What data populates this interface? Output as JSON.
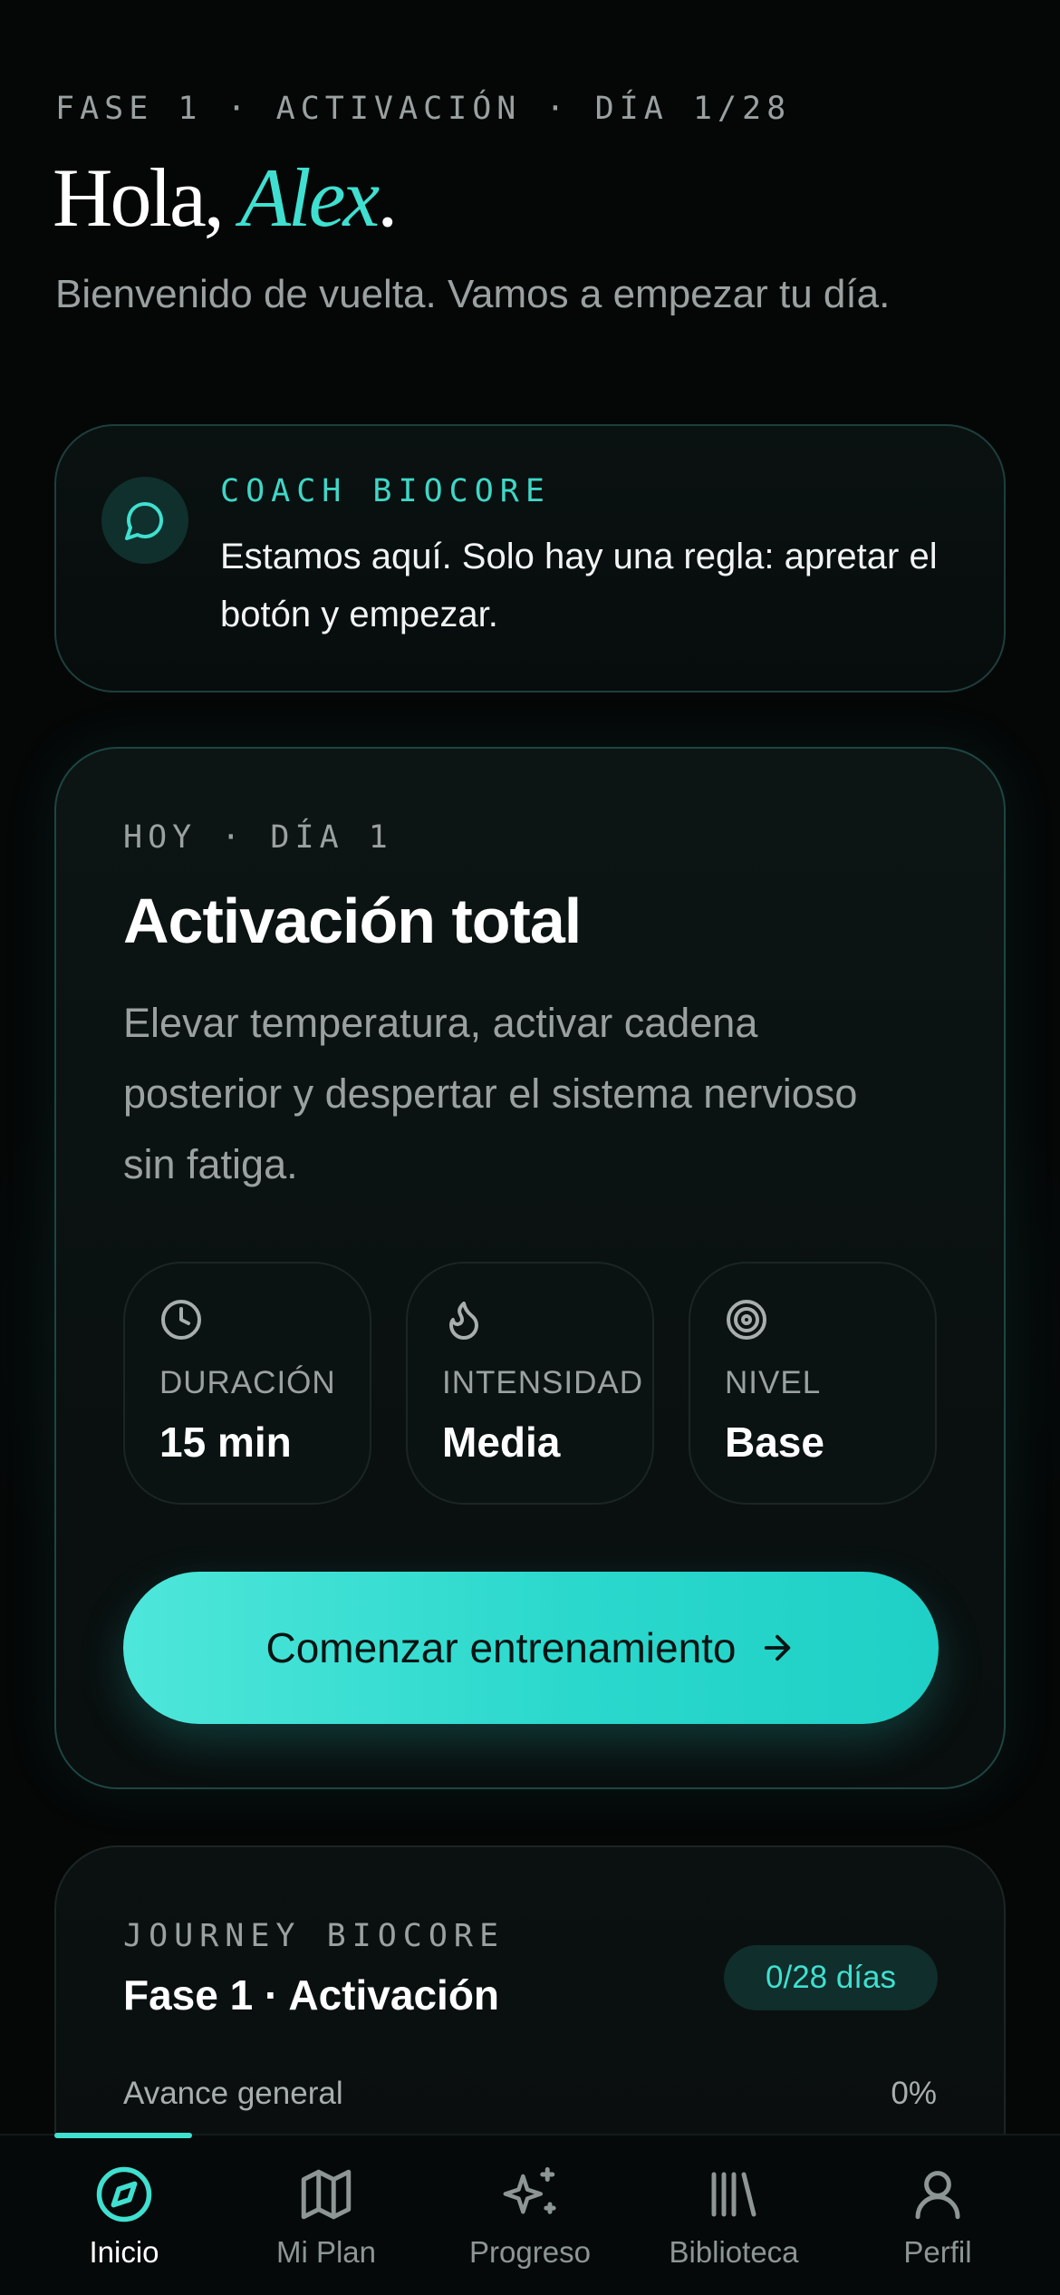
{
  "header": {
    "phase_line": "FASE 1 · ACTIVACIÓN · DÍA 1/28",
    "greeting_prefix": "Hola, ",
    "user_name": "Alex",
    "greeting_suffix": ".",
    "welcome": "Bienvenido de vuelta. Vamos a empezar tu día."
  },
  "coach": {
    "icon": "chat-bubble-icon",
    "label": "COACH BIOCORE",
    "message": "Estamos aquí. Solo hay una regla: apretar el botón y empezar."
  },
  "today": {
    "tag": "HOY · DÍA 1",
    "title": "Activación total",
    "description": "Elevar temperatura, activar cadena posterior y despertar el sistema nervioso sin fatiga.",
    "stats": [
      {
        "icon": "clock-icon",
        "label": "DURACIÓN",
        "value": "15 min"
      },
      {
        "icon": "flame-icon",
        "label": "INTENSIDAD",
        "value": "Media"
      },
      {
        "icon": "target-icon",
        "label": "NIVEL",
        "value": "Base"
      }
    ],
    "cta_label": "Comenzar entrenamiento",
    "cta_icon": "arrow-right-icon"
  },
  "journey": {
    "tag": "JOURNEY BIOCORE",
    "title": "Fase 1 · Activación",
    "badge": "0/28 días",
    "progress_label": "Avance general",
    "progress_value": "0%",
    "progress_fraction": 0
  },
  "tabbar": {
    "active": "Inicio",
    "items": [
      {
        "label": "Inicio",
        "icon": "compass-icon"
      },
      {
        "label": "Mi Plan",
        "icon": "map-icon"
      },
      {
        "label": "Progreso",
        "icon": "sparkles-icon"
      },
      {
        "label": "Biblioteca",
        "icon": "library-icon"
      },
      {
        "label": "Perfil",
        "icon": "user-icon"
      }
    ]
  },
  "colors": {
    "accent": "#3fe0d0",
    "background": "#050707",
    "muted_text": "#9aa1a0"
  }
}
